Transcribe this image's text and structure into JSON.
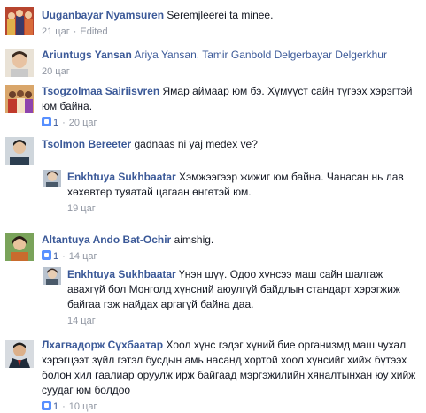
{
  "comments": [
    {
      "id": "c1",
      "author": "Uuganbayar Nyamsuren",
      "text": "Seremjleerei ta minee.",
      "time": "21 цаг",
      "edited": "Edited",
      "likes": null
    },
    {
      "id": "c2",
      "author": "Ariuntugs Yansan",
      "text": "Ariya Yansan, Tamir Ganbold Delgerbayar Delgerkhur",
      "time": "20 цаг",
      "likes": null
    },
    {
      "id": "c3",
      "author": "Tsogzolmaa Sairiisvren",
      "text": "Ямар аймаар юм бэ. Хүмүүст сайн түгээх хэрэгтэй юм байна.",
      "time": "20 цаг",
      "likes": "1"
    },
    {
      "id": "c4",
      "author": "Tsolmon Bereeter",
      "text": "gadnaas ni yaj medex ve?",
      "time": null,
      "likes": null
    },
    {
      "id": "r1",
      "author": "Enkhtuya Sukhbaatar",
      "text": "Хэмжээгээр жижиг юм байна. Чанасан нь лав хөхөвтөр туяатай цагаан өнгөтэй юм.",
      "time": "19 цаг",
      "likes": null
    },
    {
      "id": "c5",
      "author": "Altantuya Ando Bat-Ochir",
      "text": "aimshig.",
      "time": "14 цаг",
      "likes": "1"
    },
    {
      "id": "r2",
      "author": "Enkhtuya Sukhbaatar",
      "text": "Үнэн шүү. Одоо хүнсээ маш сайн шалгаж авахгүй бол Монголд хүнсний аюулгүй байдлын стандарт хэрэгжиж байгаа гэж найдах аргагүй байна даа.",
      "time": "14 цаг",
      "likes": null
    },
    {
      "id": "c6",
      "author": "Лхагвадорж Сүхбаатар",
      "text": "Хоол хүнс гэдэг хүний бие организмд маш чухал хэрэгцээт зүйл гэтэл бусдын амь насанд хортой хоол хүнсийг хийж бүтээх болон хил гаалиар оруулж ирж байгаад мэргэжилийн хяналтынхан юу хийж суудаг юм болдоо",
      "time": "10 цаг",
      "likes": "1"
    }
  ],
  "colors": {
    "name": "#3b5998",
    "meta": "#9197a3",
    "text": "#141823",
    "like": "#5890ff"
  }
}
